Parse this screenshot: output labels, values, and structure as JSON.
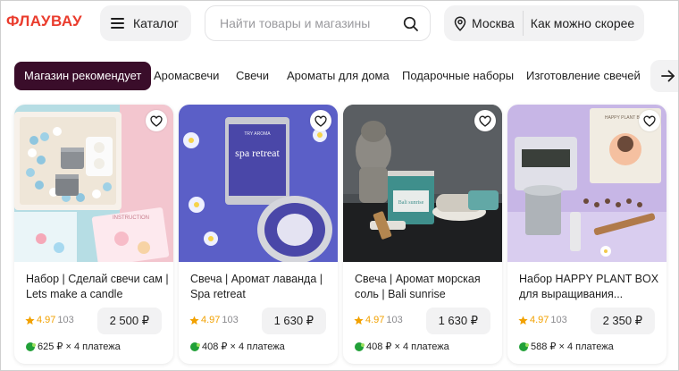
{
  "header": {
    "logo": "ФЛАУВАУ",
    "catalog_label": "Каталог",
    "search_placeholder": "Найти товары и магазины",
    "city": "Москва",
    "delivery": "Как можно скорее"
  },
  "categories": [
    "Магазин рекомендует",
    "Аромасвечи",
    "Свечи",
    "Ароматы для дома",
    "Подарочные наборы",
    "Изготовление свечей"
  ],
  "products": [
    {
      "title_lines": [
        "Набор | Сделай свечи сам |",
        "Lets make a candle"
      ],
      "rating": "4.97",
      "reviews": "103",
      "price": "2 500 ₽",
      "installment": "625 ₽ × 4 платежа"
    },
    {
      "title_lines": [
        "Свеча | Аромат лаванда |",
        "Spa retreat"
      ],
      "rating": "4.97",
      "reviews": "103",
      "price": "1 630 ₽",
      "installment": "408 ₽ × 4 платежа",
      "label": "spa retreat",
      "brand": "TRY AROMA"
    },
    {
      "title_lines": [
        "Свеча | Аромат морская",
        "соль | Bali sunrise"
      ],
      "rating": "4.97",
      "reviews": "103",
      "price": "1 630 ₽",
      "installment": "408 ₽ × 4 платежа",
      "label": "Bali sunrise"
    },
    {
      "title_lines": [
        "Набор HAPPY PLANT BOX",
        "для выращивания..."
      ],
      "rating": "4.97",
      "reviews": "103",
      "price": "2 350 ₽",
      "installment": "588 ₽ × 4 платежа",
      "label": "HAPPY PLANT BOX"
    }
  ],
  "colors": {
    "brand": "#ea3c2d",
    "active_chip": "#3a0d2a",
    "rating_star": "#f2a100",
    "installment_leaf": "#21a038"
  },
  "icons": {
    "catalog": "menu-icon",
    "search": "search-icon",
    "location": "location-pin-icon",
    "scroll": "arrow-right-icon",
    "favorite": "heart-icon",
    "rating": "star-icon",
    "installment": "split-payment-icon"
  }
}
